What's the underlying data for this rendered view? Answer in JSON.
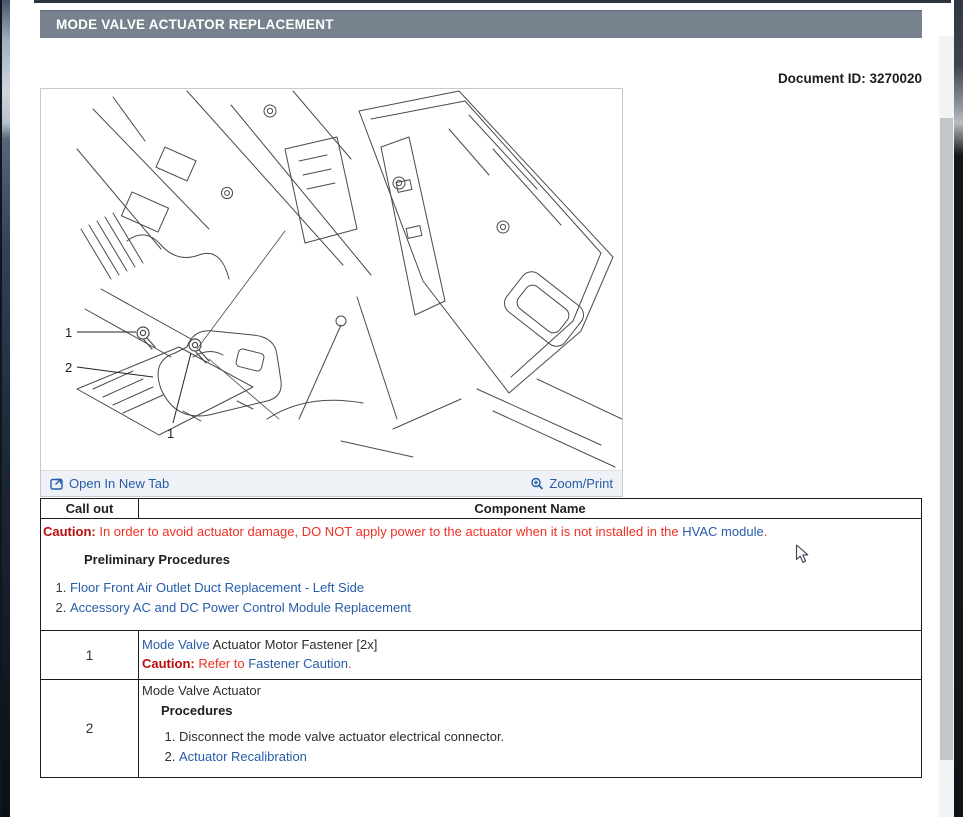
{
  "header": {
    "title": "MODE VALVE ACTUATOR REPLACEMENT"
  },
  "document_id": "Document ID: 3270020",
  "figure": {
    "open_in_new_tab_label": "Open In New Tab",
    "zoom_print_label": "Zoom/Print",
    "callouts": [
      "1",
      "2",
      "1"
    ]
  },
  "table": {
    "columns": {
      "callout": "Call out",
      "component": "Component Name"
    },
    "caution_row": {
      "label": "Caution:",
      "text": "In order to avoid actuator damage, DO NOT apply power to the actuator when it is not installed in the",
      "link": "HVAC module",
      "suffix": ".",
      "preliminary_title": "Preliminary Procedures",
      "preliminary_links": [
        "Floor Front Air Outlet Duct Replacement - Left Side",
        "Accessory AC and DC Power Control Module Replacement"
      ]
    },
    "rows": [
      {
        "callout": "1",
        "name_link": "Mode Valve",
        "name_rest": "Actuator Motor Fastener [2x]",
        "caution_label": "Caution:",
        "caution_text": "Refer to",
        "caution_link": "Fastener Caution",
        "caution_suffix": "."
      },
      {
        "callout": "2",
        "name": "Mode Valve Actuator",
        "procedures_title": "Procedures",
        "steps": [
          {
            "text": "Disconnect the mode valve actuator electrical connector."
          },
          {
            "link": "Actuator Recalibration"
          }
        ]
      }
    ]
  },
  "colors": {
    "link_blue": "#275ca8",
    "caution_red": "#ef3125",
    "caution_label_red": "#bb0c0c",
    "title_bar_bg": "#78828f",
    "figure_footer_bg": "#eef1f5"
  }
}
